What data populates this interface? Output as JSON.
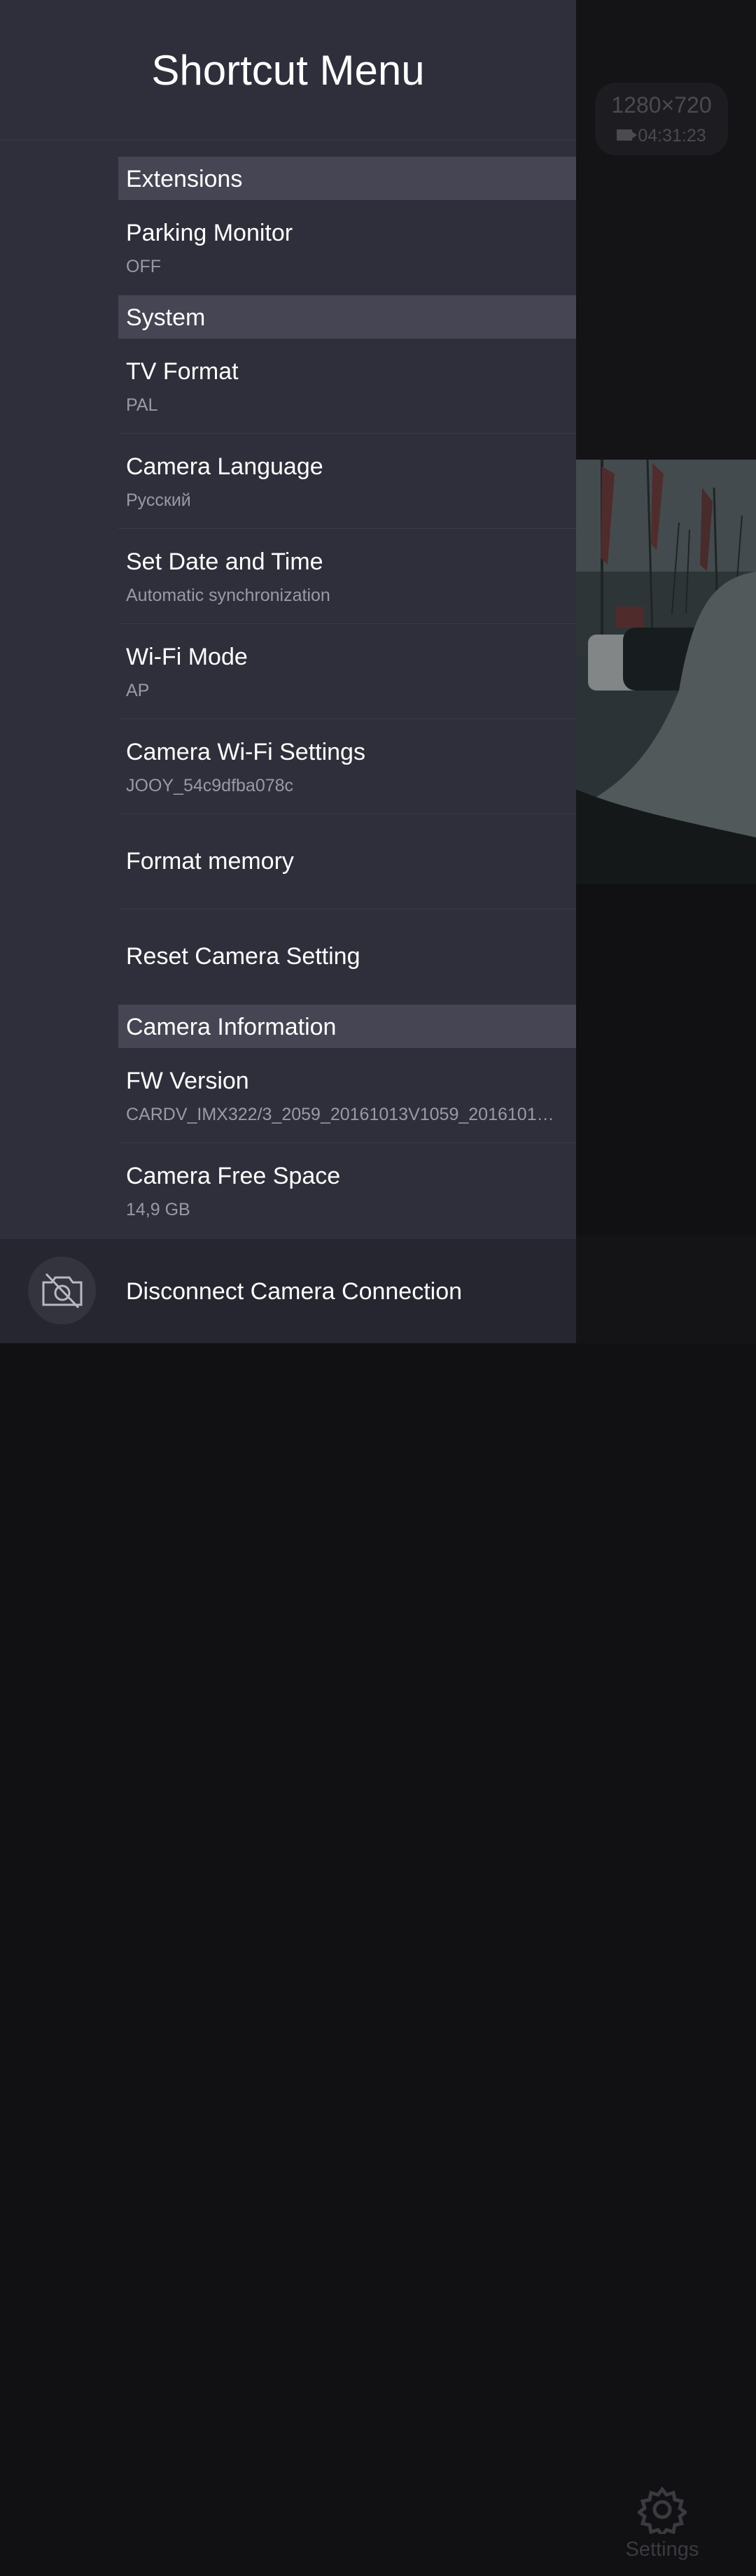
{
  "drawer": {
    "title": "Shortcut Menu",
    "sections": [
      {
        "header": "Extensions",
        "items": [
          {
            "label": "Parking Monitor",
            "value": "OFF"
          }
        ]
      },
      {
        "header": "System",
        "items": [
          {
            "label": "TV Format",
            "value": "PAL"
          },
          {
            "label": "Camera Language",
            "value": "Русский"
          },
          {
            "label": "Set Date and Time",
            "value": "Automatic synchronization"
          },
          {
            "label": "Wi-Fi Mode",
            "value": "AP"
          },
          {
            "label": "Camera Wi-Fi Settings",
            "value": "JOOY_54c9dfba078c"
          },
          {
            "label": "Format memory",
            "value": ""
          },
          {
            "label": "Reset Camera Setting",
            "value": ""
          }
        ]
      },
      {
        "header": "Camera Information",
        "items": [
          {
            "label": "FW Version",
            "value": "CARDV_IMX322/3_2059_20161013V1059_2016101…"
          },
          {
            "label": "Camera Free Space",
            "value": "14,9 GB"
          }
        ]
      }
    ],
    "footer": {
      "icon": "camera-off-icon",
      "label": "Disconnect Camera Connection"
    }
  },
  "background": {
    "video": {
      "resolution": "1280×720",
      "recording_time": "04:31:23"
    },
    "bottom_nav": {
      "settings_label": "Settings",
      "settings_icon": "gear-icon"
    }
  },
  "colors": {
    "drawer_bg": "#2f2f3b",
    "section_header_bg": "#454553",
    "secondary_text": "#9a9aa4",
    "footer_bg": "#262630"
  }
}
